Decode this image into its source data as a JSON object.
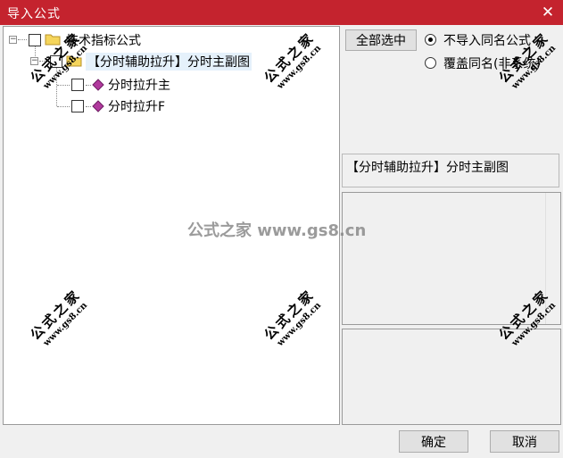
{
  "window": {
    "title": "导入公式",
    "close_glyph": "✕"
  },
  "tree": {
    "root_label": "技术指标公式",
    "group_label": "【分时辅助拉升】分时主副图",
    "items": [
      {
        "label": "分时拉升主"
      },
      {
        "label": "分时拉升F"
      }
    ],
    "expander_collapse": "−"
  },
  "right_panel": {
    "select_all_label": "全部选中",
    "radio_options": [
      {
        "label": "不导入同名公式",
        "checked": true
      },
      {
        "label": "覆盖同名(非系统)",
        "checked": false
      }
    ],
    "selected_formula_label": "【分时辅助拉升】分时主副图"
  },
  "footer": {
    "ok_label": "确定",
    "cancel_label": "取消"
  },
  "watermarks": {
    "brand_text": "公式之家",
    "url_text": "www.gs8.cn",
    "center_text": "公式之家 www.gs8.cn"
  },
  "colors": {
    "titlebar": "#c4232e",
    "folder": "#f5d55b",
    "gem": "#b0399d"
  },
  "icons": {
    "folder": "folder-icon",
    "formula": "formula-gem-icon",
    "close": "close-icon"
  }
}
